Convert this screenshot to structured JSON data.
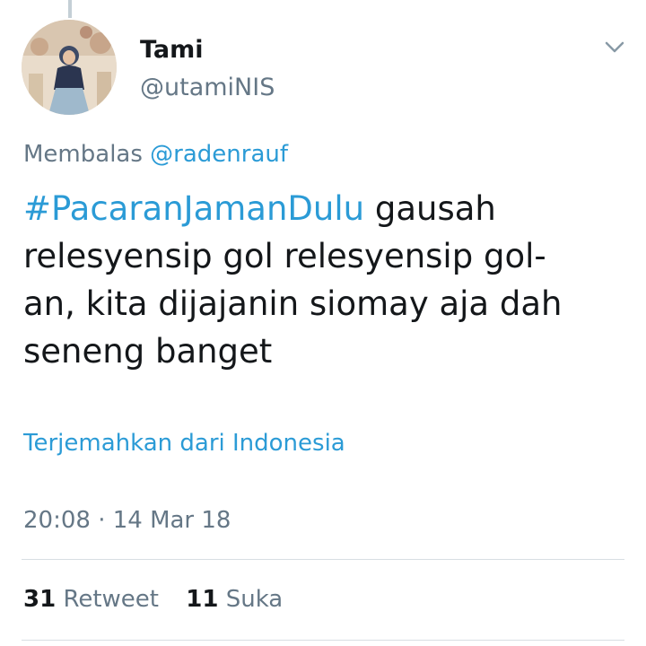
{
  "tweet": {
    "author": {
      "display_name": "Tami",
      "handle": "@utamiNIS"
    },
    "reply_prefix": "Membalas",
    "reply_to": "@radenrauf",
    "text_lines": [
      {
        "hashtag": "#PacaranJamanDulu",
        "rest": " gausah"
      },
      {
        "hashtag": "",
        "rest": "relesyensip gol relesyensip gol-"
      },
      {
        "hashtag": "",
        "rest": "an, kita dijajanin siomay aja dah"
      },
      {
        "hashtag": "",
        "rest": "seneng banget"
      }
    ],
    "translate_label": "Terjemahkan dari Indonesia",
    "timestamp": "20:08 · 14 Mar 18",
    "stats": {
      "retweet_count": "31",
      "retweet_label": "Retweet",
      "like_count": "11",
      "like_label": "Suka"
    }
  },
  "colors": {
    "link": "#2b9bd6",
    "secondary_text": "#657786",
    "primary_text": "#14171a",
    "divider": "#d8dee3"
  },
  "icons": {
    "menu": "chevron-down-icon"
  }
}
